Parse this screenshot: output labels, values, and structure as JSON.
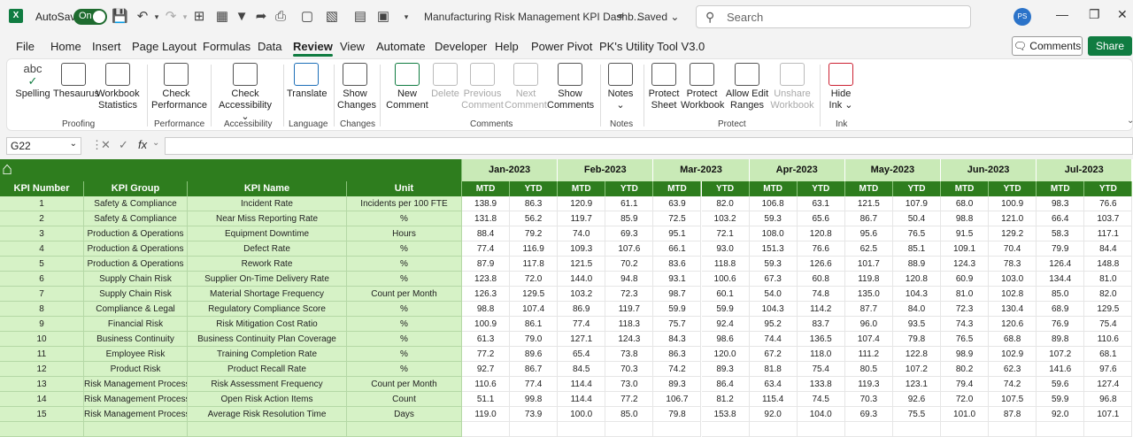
{
  "titlebar": {
    "app_icon": "excel-icon",
    "autosave_label": "AutoSave",
    "autosave_state": "On",
    "doc_title": "Manufacturing Risk Management KPI Dashb...",
    "saved_status": "Saved",
    "search_placeholder": "Search",
    "avatar_initials": "PS"
  },
  "menu": {
    "tabs": [
      "File",
      "Home",
      "Insert",
      "Page Layout",
      "Formulas",
      "Data",
      "Review",
      "View",
      "Automate",
      "Developer",
      "Help",
      "Power Pivot",
      "PK's Utility Tool V3.0"
    ],
    "active": "Review",
    "comments_button": "Comments",
    "share_button": "Share"
  },
  "ribbon": {
    "buttons": [
      {
        "label": "Spelling",
        "icon": "spelling-icon",
        "enabled": true
      },
      {
        "label": "Thesaurus",
        "icon": "thesaurus-icon",
        "enabled": true
      },
      {
        "label": "Workbook Statistics",
        "icon": "workbook-statistics-icon",
        "enabled": true
      },
      {
        "label": "Check Performance",
        "icon": "check-performance-icon",
        "enabled": true
      },
      {
        "label": "Check Accessibility",
        "icon": "check-accessibility-icon",
        "enabled": true
      },
      {
        "label": "Translate",
        "icon": "translate-icon",
        "enabled": true
      },
      {
        "label": "Show Changes",
        "icon": "show-changes-icon",
        "enabled": true
      },
      {
        "label": "New Comment",
        "icon": "new-comment-icon",
        "enabled": true
      },
      {
        "label": "Delete",
        "icon": "delete-comment-icon",
        "enabled": false
      },
      {
        "label": "Previous Comment",
        "icon": "previous-comment-icon",
        "enabled": false
      },
      {
        "label": "Next Comment",
        "icon": "next-comment-icon",
        "enabled": false
      },
      {
        "label": "Show Comments",
        "icon": "show-comments-icon",
        "enabled": true
      },
      {
        "label": "Notes",
        "icon": "notes-icon",
        "enabled": true
      },
      {
        "label": "Protect Sheet",
        "icon": "protect-sheet-icon",
        "enabled": true
      },
      {
        "label": "Protect Workbook",
        "icon": "protect-workbook-icon",
        "enabled": true
      },
      {
        "label": "Allow Edit Ranges",
        "icon": "allow-edit-ranges-icon",
        "enabled": true
      },
      {
        "label": "Unshare Workbook",
        "icon": "unshare-workbook-icon",
        "enabled": false
      },
      {
        "label": "Hide Ink",
        "icon": "hide-ink-icon",
        "enabled": true
      }
    ],
    "groups": [
      "Proofing",
      "Performance",
      "Accessibility",
      "Language",
      "Changes",
      "Comments",
      "Notes",
      "Protect",
      "Ink"
    ]
  },
  "formula_bar": {
    "name_box": "G22",
    "fx_label": "fx",
    "formula": ""
  },
  "sheet": {
    "home_icon": "home-icon",
    "left_headers": [
      "KPI Number",
      "KPI Group",
      "KPI Name",
      "Unit"
    ],
    "months": [
      "Jan-2023",
      "Feb-2023",
      "Mar-2023",
      "Apr-2023",
      "May-2023",
      "Jun-2023",
      "Jul-2023"
    ],
    "sub_headers": [
      "MTD",
      "YTD"
    ],
    "rows": [
      {
        "num": "1",
        "group": "Safety & Compliance",
        "name": "Incident Rate",
        "unit": "Incidents per 100 FTE",
        "values": [
          "138.9",
          "86.3",
          "120.9",
          "61.1",
          "63.9",
          "82.0",
          "106.8",
          "63.1",
          "121.5",
          "107.9",
          "68.0",
          "100.9",
          "98.3",
          "76.6"
        ]
      },
      {
        "num": "2",
        "group": "Safety & Compliance",
        "name": "Near Miss Reporting Rate",
        "unit": "%",
        "values": [
          "131.8",
          "56.2",
          "119.7",
          "85.9",
          "72.5",
          "103.2",
          "59.3",
          "65.6",
          "86.7",
          "50.4",
          "98.8",
          "121.0",
          "66.4",
          "103.7"
        ]
      },
      {
        "num": "3",
        "group": "Production & Operations",
        "name": "Equipment Downtime",
        "unit": "Hours",
        "values": [
          "88.4",
          "79.2",
          "74.0",
          "69.3",
          "95.1",
          "72.1",
          "108.0",
          "120.8",
          "95.6",
          "76.5",
          "91.5",
          "129.2",
          "58.3",
          "117.1"
        ]
      },
      {
        "num": "4",
        "group": "Production & Operations",
        "name": "Defect Rate",
        "unit": "%",
        "values": [
          "77.4",
          "116.9",
          "109.3",
          "107.6",
          "66.1",
          "93.0",
          "151.3",
          "76.6",
          "62.5",
          "85.1",
          "109.1",
          "70.4",
          "79.9",
          "84.4"
        ]
      },
      {
        "num": "5",
        "group": "Production & Operations",
        "name": "Rework Rate",
        "unit": "%",
        "values": [
          "87.9",
          "117.8",
          "121.5",
          "70.2",
          "83.6",
          "118.8",
          "59.3",
          "126.6",
          "101.7",
          "88.9",
          "124.3",
          "78.3",
          "126.4",
          "148.8"
        ]
      },
      {
        "num": "6",
        "group": "Supply Chain Risk",
        "name": "Supplier On-Time Delivery Rate",
        "unit": "%",
        "values": [
          "123.8",
          "72.0",
          "144.0",
          "94.8",
          "93.1",
          "100.6",
          "67.3",
          "60.8",
          "119.8",
          "120.8",
          "60.9",
          "103.0",
          "134.4",
          "81.0"
        ]
      },
      {
        "num": "7",
        "group": "Supply Chain Risk",
        "name": "Material Shortage Frequency",
        "unit": "Count per Month",
        "values": [
          "126.3",
          "129.5",
          "103.2",
          "72.3",
          "98.7",
          "60.1",
          "54.0",
          "74.8",
          "135.0",
          "104.3",
          "81.0",
          "102.8",
          "85.0",
          "82.0"
        ]
      },
      {
        "num": "8",
        "group": "Compliance & Legal",
        "name": "Regulatory Compliance Score",
        "unit": "%",
        "values": [
          "98.8",
          "107.4",
          "86.9",
          "119.7",
          "59.9",
          "59.9",
          "104.3",
          "114.2",
          "87.7",
          "84.0",
          "72.3",
          "130.4",
          "68.9",
          "129.5"
        ]
      },
      {
        "num": "9",
        "group": "Financial Risk",
        "name": "Risk Mitigation Cost Ratio",
        "unit": "%",
        "values": [
          "100.9",
          "86.1",
          "77.4",
          "118.3",
          "75.7",
          "92.4",
          "95.2",
          "83.7",
          "96.0",
          "93.5",
          "74.3",
          "120.6",
          "76.9",
          "75.4"
        ]
      },
      {
        "num": "10",
        "group": "Business Continuity",
        "name": "Business Continuity Plan Coverage",
        "unit": "%",
        "values": [
          "61.3",
          "79.0",
          "127.1",
          "124.3",
          "84.3",
          "98.6",
          "74.4",
          "136.5",
          "107.4",
          "79.8",
          "76.5",
          "68.8",
          "89.8",
          "110.6"
        ]
      },
      {
        "num": "11",
        "group": "Employee Risk",
        "name": "Training Completion Rate",
        "unit": "%",
        "values": [
          "77.2",
          "89.6",
          "65.4",
          "73.8",
          "86.3",
          "120.0",
          "67.2",
          "118.0",
          "111.2",
          "122.8",
          "98.9",
          "102.9",
          "107.2",
          "68.1"
        ]
      },
      {
        "num": "12",
        "group": "Product Risk",
        "name": "Product Recall Rate",
        "unit": "%",
        "values": [
          "92.7",
          "86.7",
          "84.5",
          "70.3",
          "74.2",
          "89.3",
          "81.8",
          "75.4",
          "80.5",
          "107.2",
          "80.2",
          "62.3",
          "141.6",
          "97.6"
        ]
      },
      {
        "num": "13",
        "group": "Risk Management Process",
        "name": "Risk Assessment Frequency",
        "unit": "Count per Month",
        "values": [
          "110.6",
          "77.4",
          "114.4",
          "73.0",
          "89.3",
          "86.4",
          "63.4",
          "133.8",
          "119.3",
          "123.1",
          "79.4",
          "74.2",
          "59.6",
          "127.4"
        ]
      },
      {
        "num": "14",
        "group": "Risk Management Process",
        "name": "Open Risk Action Items",
        "unit": "Count",
        "values": [
          "51.1",
          "99.8",
          "114.4",
          "77.2",
          "106.7",
          "81.2",
          "115.4",
          "74.5",
          "70.3",
          "92.6",
          "72.0",
          "107.5",
          "59.9",
          "96.8"
        ]
      },
      {
        "num": "15",
        "group": "Risk Management Process",
        "name": "Average Risk Resolution Time",
        "unit": "Days",
        "values": [
          "119.0",
          "73.9",
          "100.0",
          "85.0",
          "79.8",
          "153.8",
          "92.0",
          "104.0",
          "69.3",
          "75.5",
          "101.0",
          "87.8",
          "92.0",
          "107.1"
        ]
      }
    ]
  }
}
